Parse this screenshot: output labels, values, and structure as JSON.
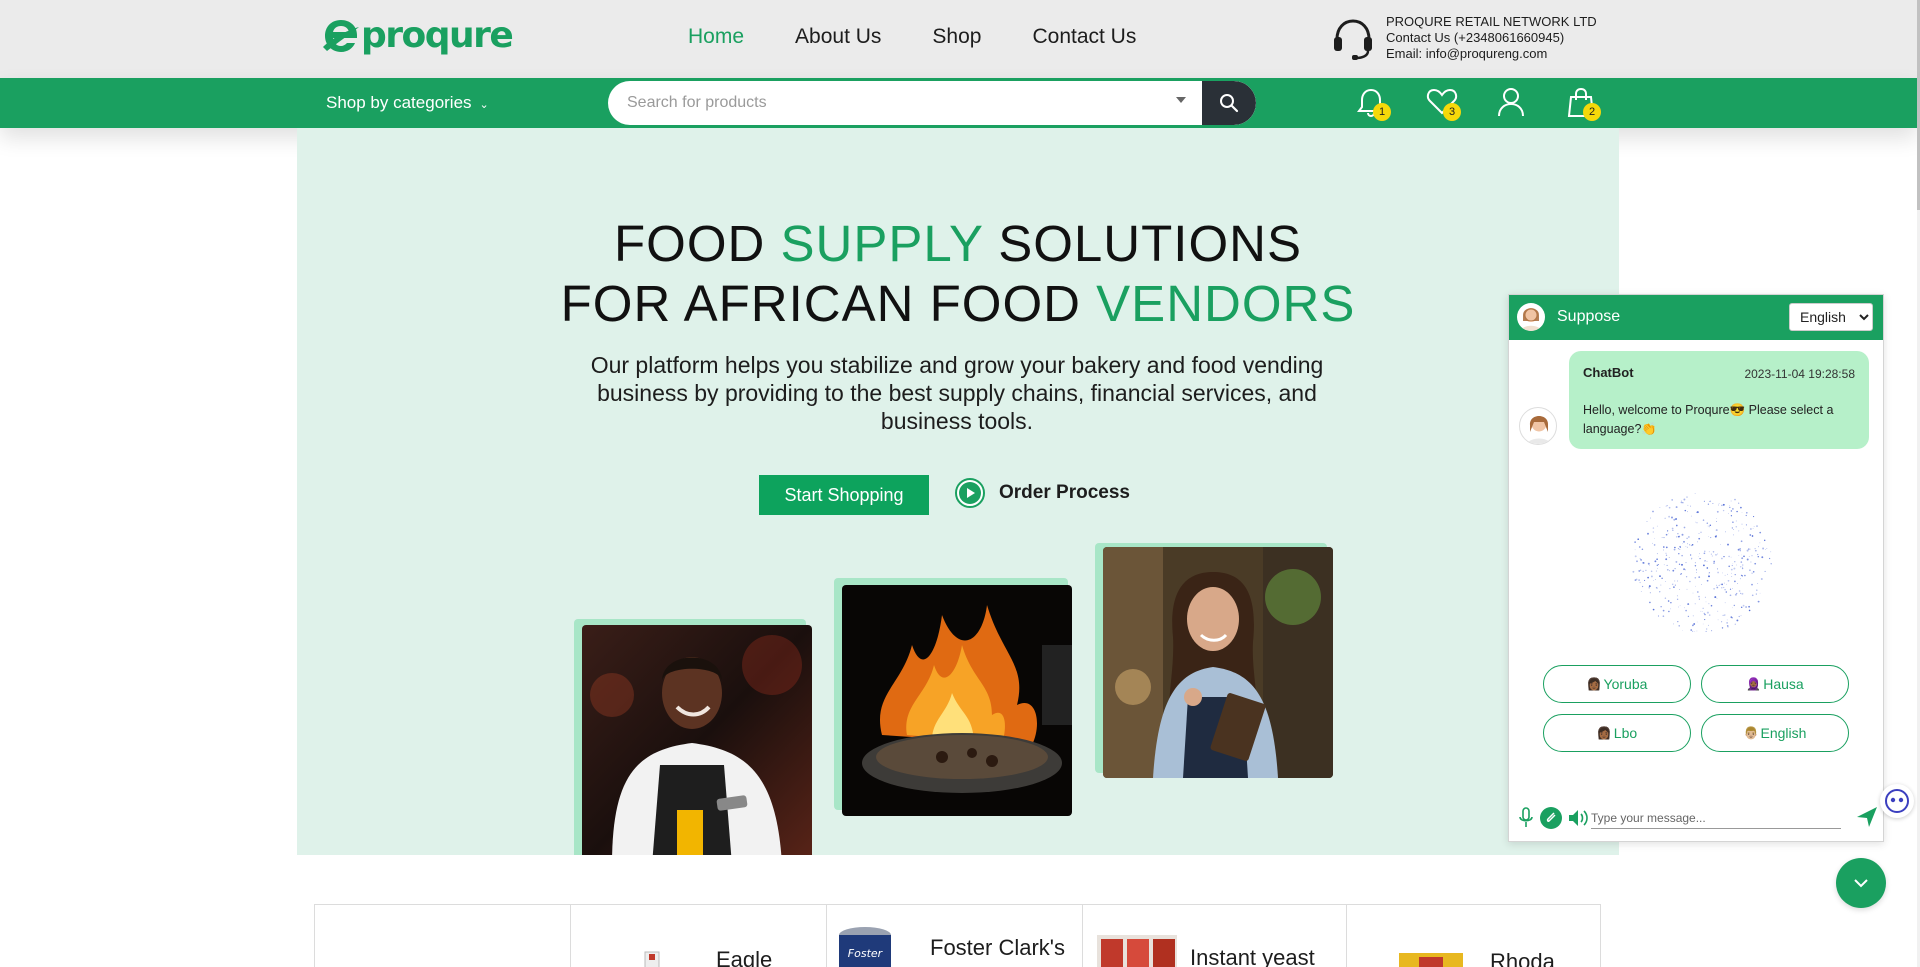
{
  "colors": {
    "brand": "#1aa060",
    "hero_bg": "#dff2ea",
    "badge": "#f5d90a"
  },
  "logo": {
    "text": "proqure"
  },
  "nav": {
    "items": [
      {
        "label": "Home",
        "active": true
      },
      {
        "label": "About Us",
        "active": false
      },
      {
        "label": "Shop",
        "active": false
      },
      {
        "label": "Contact Us",
        "active": false
      }
    ]
  },
  "contact": {
    "company": "PROQURE RETAIL NETWORK LTD",
    "phone": "Contact Us (+2348061660945)",
    "email": "Email: info@proqureng.com"
  },
  "categories": {
    "label": "Shop by categories"
  },
  "search": {
    "placeholder": "Search for products",
    "value": ""
  },
  "header_icons": {
    "notifications": {
      "icon": "bell-icon",
      "count": "1"
    },
    "wishlist": {
      "icon": "heart-icon",
      "count": "3"
    },
    "account": {
      "icon": "user-icon"
    },
    "cart": {
      "icon": "shopping-bag-icon",
      "count": "2"
    }
  },
  "hero": {
    "title_line1_a": "FOOD ",
    "title_line1_b": "SUPPLY",
    "title_line1_c": " SOLUTIONS",
    "title_line2_a": "FOR AFRICAN FOOD ",
    "title_line2_b": "VENDORS",
    "description": "Our platform helps you stabilize and grow your bakery and food vending business by providing to the best supply chains, financial services, and business tools.",
    "primary_button": "Start Shopping",
    "secondary_link": "Order Process"
  },
  "products": [
    {
      "title": "Eagle"
    },
    {
      "title": "Foster Clark's"
    },
    {
      "title": "Instant yeast"
    },
    {
      "title": "Rhoda"
    }
  ],
  "chat": {
    "title": "Suppose",
    "language_selected": "English",
    "language_options": [
      "English"
    ],
    "message": {
      "sender": "ChatBot",
      "timestamp": "2023-11-04 19:28:58",
      "text": "Hello, welcome to Proqure😎 Please select a language?👏"
    },
    "languages": [
      {
        "emoji": "👩🏾",
        "label": "Yoruba"
      },
      {
        "emoji": "🧕🏾",
        "label": "Hausa"
      },
      {
        "emoji": "👩🏾",
        "label": "Lbo"
      },
      {
        "emoji": "👨🏼",
        "label": "English"
      }
    ],
    "input_placeholder": "Type your message..."
  }
}
